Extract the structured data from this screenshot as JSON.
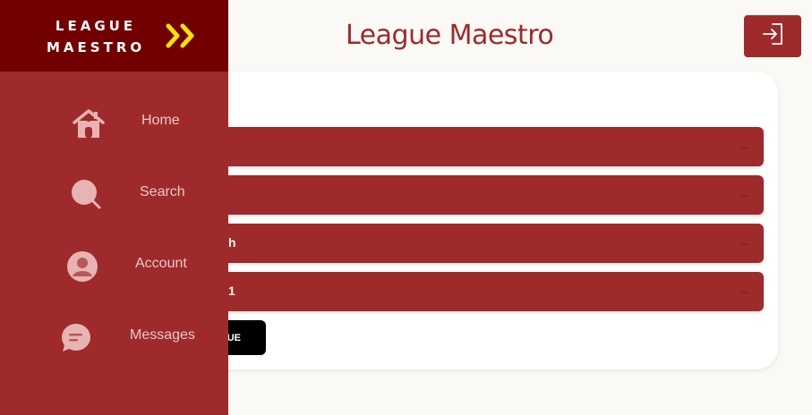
{
  "app": {
    "title": "League Maestro"
  },
  "brand": {
    "line1": "LEAGUE",
    "line2": "MAESTRO",
    "accent": "#ffe600"
  },
  "header": {
    "logout_icon": "sign-in-icon"
  },
  "nav": {
    "items": [
      {
        "label": "Home",
        "icon": "home-icon"
      },
      {
        "label": "Search",
        "icon": "search-icon"
      },
      {
        "label": "Account",
        "icon": "user-icon"
      },
      {
        "label": "Messages",
        "icon": "chat-icon"
      }
    ]
  },
  "leagues": [
    {
      "name": "",
      "more": "..."
    },
    {
      "name": "",
      "more": "..."
    },
    {
      "name": "h",
      "more": "..."
    },
    {
      "name": "1",
      "more": "..."
    }
  ],
  "action_button": {
    "label": "UE"
  },
  "colors": {
    "primary": "#9e2a2b",
    "brand_bg": "#720000",
    "page_bg": "#fbf9f5"
  }
}
